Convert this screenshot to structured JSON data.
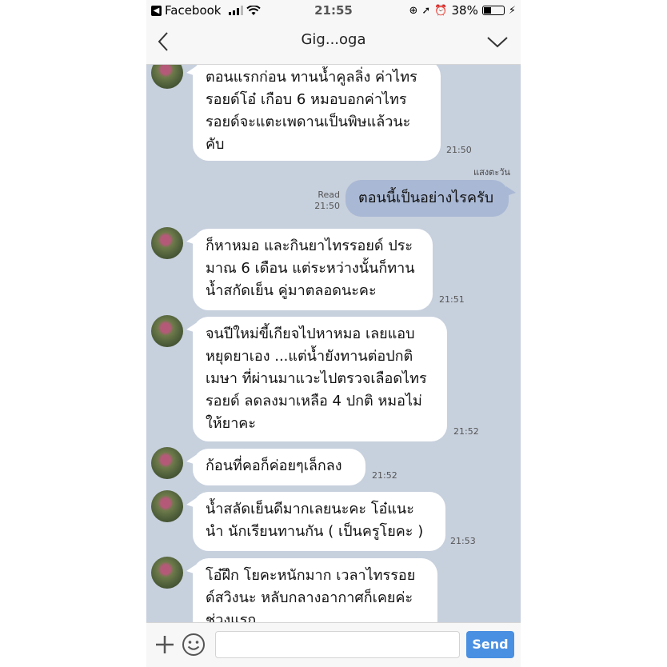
{
  "statusbar": {
    "app_back": "Facebook",
    "time": "21:55",
    "battery": "38%",
    "battery_level": 0.38
  },
  "header": {
    "title": "Gig...oga"
  },
  "messages": [
    {
      "direction": "in",
      "text": "ตอนแรกก่อน ทานน้ำคูลลิ่ง ค่าไทร\nรอยด์โอ๋ เกือบ 6   หมอบอกค่าไทร\nรอยด์จะแตะเพดานเป็นพิษแล้วนะ\nคับ",
      "time": "21:50"
    },
    {
      "direction": "out",
      "sender": "แสงตะวัน",
      "text": "ตอนนี้เป็นอย่างไรครับ",
      "status": "Read",
      "time": "21:50"
    },
    {
      "direction": "in",
      "text": "ก็หาหมอ และกินยาไทรรอยด์ ประ\nมาณ 6 เดือน แต่ระหว่างนั้นก็ทาน\nน้ำสกัดเย็น คู่มาตลอดนะคะ",
      "time": "21:51"
    },
    {
      "direction": "in",
      "text": "จนปีใหม่ขี้เกียจไปหาหมอ เลยแอบ\nหยุดยาเอง ...แต่น้ำยังทานต่อปกติ\nเมษา ที่ผ่านมาแวะไปตรวจเลือดไทร\nรอยด์ ลดลงมาเหลือ 4 ปกติ หมอไม่\nให้ยาคะ",
      "time": "21:52"
    },
    {
      "direction": "in",
      "text": "ก้อนที่คอก็ค่อยๆเล็กลง",
      "time": "21:52"
    },
    {
      "direction": "in",
      "text": "น้ำสลัดเย็นดีมากเลยนะคะ โอ๋แนะ\nนำ นักเรียนทานกัน ( เป็นครูโยคะ )",
      "time": "21:53"
    },
    {
      "direction": "in",
      "text": "โอ๋ฝึก โยคะหนักมาก เวลาไทรรอย\nด์สวิงนะ หลับกลางอากาศก็เคยค่ะ\nช่วงแรก",
      "time": ""
    }
  ],
  "input": {
    "placeholder": "",
    "send_label": "Send"
  },
  "colors": {
    "chat_bg": "#c7d0dd",
    "out_bubble": "#a9b8d4",
    "send_button": "#4a90e2"
  }
}
